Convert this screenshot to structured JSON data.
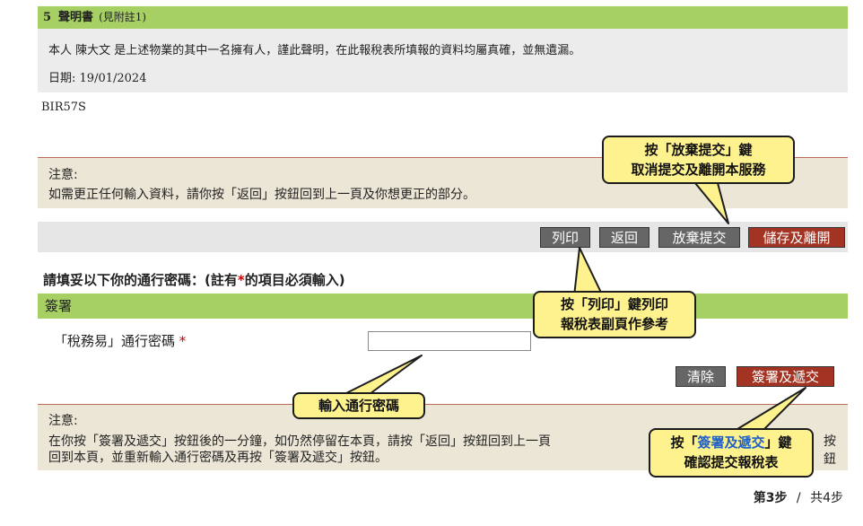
{
  "declaration": {
    "section_number": "5",
    "title": "聲明書",
    "note": "(見附註1)",
    "text": "本人 陳大文 是上述物業的其中一名擁有人，謹此聲明，在此報稅表所填報的資料均屬真確，並無遺漏。",
    "date_label": "日期:",
    "date_value": "19/01/2024"
  },
  "form_code": "BIR57S",
  "notice1": {
    "heading": "注意:",
    "text": "如需更正任何輸入資料，請你按「返回」按鈕回到上一頁及你想更正的部分。"
  },
  "buttons": {
    "print": "列印",
    "back": "返回",
    "abandon": "放棄提交",
    "save_exit": "儲存及離開",
    "clear": "清除",
    "sign_submit": "簽署及遞交"
  },
  "password_prompt": {
    "before": "請填妥以下你的通行密碼：(註有",
    "star": "*",
    "after": "的項目必須輸入)"
  },
  "signature": {
    "heading": "簽署",
    "label": "「稅務易」通行密碼",
    "required_mark": "*",
    "input_value": ""
  },
  "notice2": {
    "heading": "注意:",
    "line1": "在你按「簽署及遞交」按鈕後的一分鐘，如仍然停留在本頁，請按「返回」按鈕回到上一頁",
    "line1_tail": "按鈕",
    "line2": "回到本頁，並重新輸入通行密碼及再按「簽署及遞交」按鈕。"
  },
  "callouts": {
    "abandon_line1": "按「放棄提交」鍵",
    "abandon_line2": "取消提交及離開本服務",
    "print_line1": "按「列印」鍵列印",
    "print_line2": "報稅表副頁作參考",
    "password": "輸入通行密碼",
    "sign_pre": "按「",
    "sign_hl": "簽署及遞交",
    "sign_post": "」鍵",
    "sign_line2": "確認提交報稅表"
  },
  "step": {
    "current": "第3步",
    "separator": "/",
    "total": "共4步"
  },
  "colors": {
    "section_green": "#a6cf64",
    "button_grey": "#666666",
    "button_red": "#a33322",
    "callout_yellow": "#fef28e",
    "notice_bg": "#ece6d7"
  }
}
